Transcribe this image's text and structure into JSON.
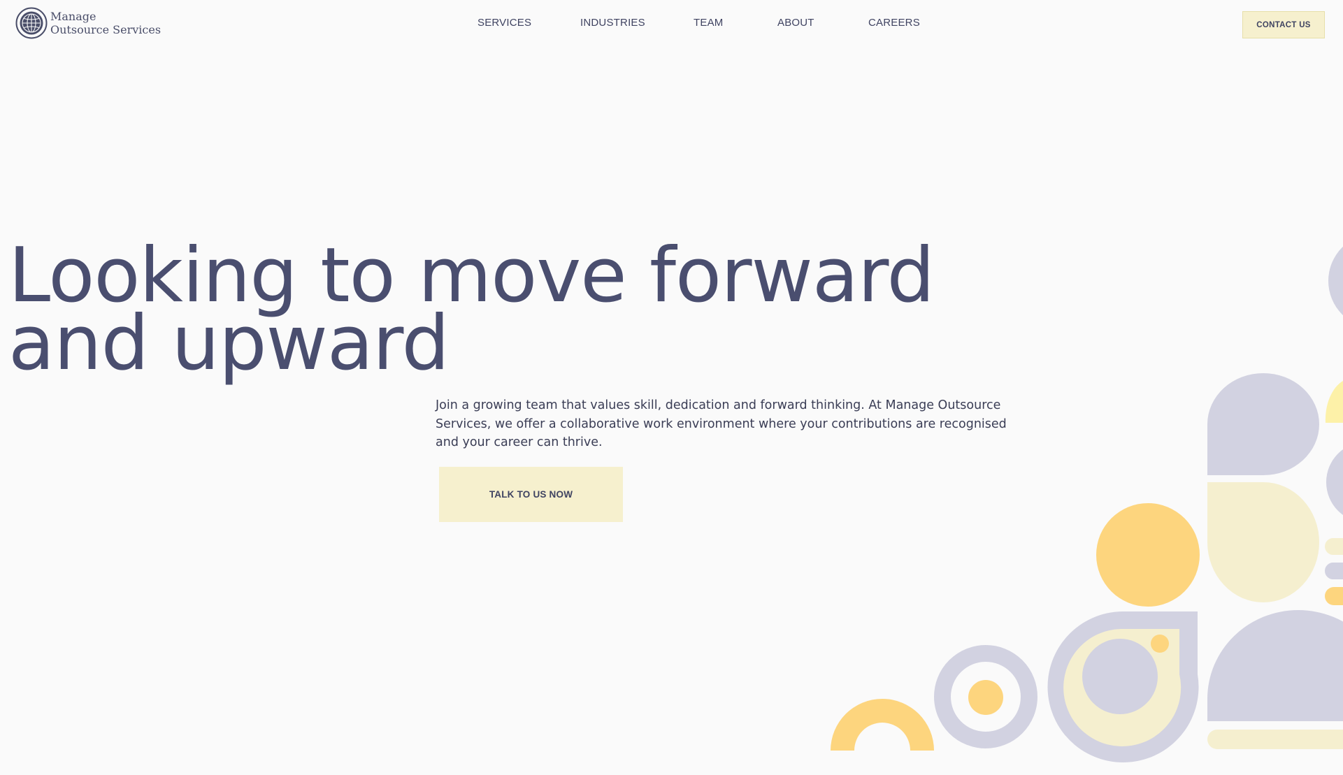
{
  "header": {
    "logo": {
      "line1": "Manage",
      "line2": "Outsource Services",
      "icon": "globe-icon"
    },
    "nav": [
      {
        "label": "SERVICES"
      },
      {
        "label": "INDUSTRIES"
      },
      {
        "label": "TEAM"
      },
      {
        "label": "ABOUT"
      },
      {
        "label": "CAREERS"
      }
    ],
    "contact_label": "CONTACT US"
  },
  "hero": {
    "title_line1": "Looking to move forward",
    "title_line2": "and upward",
    "description": "Join a growing team that values skill, dedication and forward thinking. At Manage Outsource Services, we offer a collaborative work environment where your contributions are recognised and your career can thrive.",
    "cta_label": "TALK TO US NOW"
  },
  "colors": {
    "background": "#fafafa",
    "text": "#4a4e6f",
    "button": "#f6f0ce",
    "lavender": "#d2d2e1",
    "yellow": "#fdd57e",
    "cream": "#f5efcf"
  }
}
